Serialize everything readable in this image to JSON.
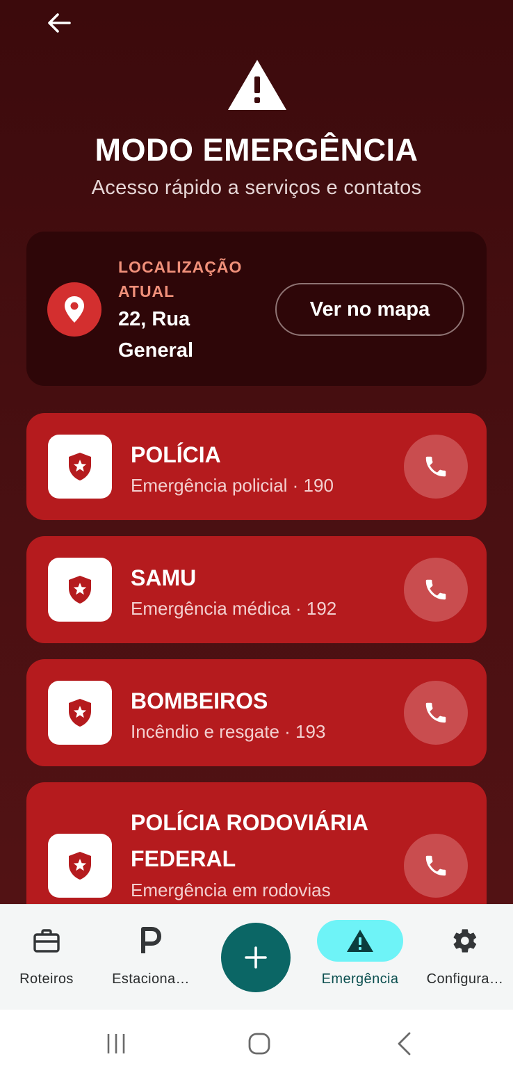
{
  "header": {
    "back_icon": "arrow-left-icon",
    "hero_icon": "warning-triangle-icon",
    "title": "MODO EMERGÊNCIA",
    "subtitle": "Acesso rápido a serviços e contatos"
  },
  "location": {
    "icon": "location-pin-icon",
    "label": "LOCALIZAÇÃO ATUAL",
    "address": "22, Rua General",
    "map_button": "Ver no mapa"
  },
  "services": [
    {
      "name": "POLÍCIA",
      "description": "Emergência policial · 190",
      "icon": "shield-star-icon",
      "call_icon": "phone-icon"
    },
    {
      "name": "SAMU",
      "description": "Emergência médica · 192",
      "icon": "shield-star-icon",
      "call_icon": "phone-icon"
    },
    {
      "name": "BOMBEIROS",
      "description": "Incêndio e resgate · 193",
      "icon": "shield-star-icon",
      "call_icon": "phone-icon"
    },
    {
      "name": "POLÍCIA RODOVIÁRIA FEDERAL",
      "description": "Emergência em rodovias",
      "icon": "shield-star-icon",
      "call_icon": "phone-icon"
    }
  ],
  "bottom_nav": {
    "items": [
      {
        "label": "Roteiros",
        "icon": "briefcase-icon"
      },
      {
        "label": "Estaciona…",
        "icon": "parking-icon"
      },
      {
        "label": "Emergência",
        "icon": "warning-triangle-icon",
        "active": true
      },
      {
        "label": "Configura…",
        "icon": "gear-icon"
      }
    ],
    "fab_icon": "plus-icon"
  },
  "colors": {
    "background": "#3c0a0c",
    "card": "#b51b1e",
    "accent_label": "#f0907a",
    "nav_active": "#6ef3f7",
    "fab": "#0b6665"
  }
}
